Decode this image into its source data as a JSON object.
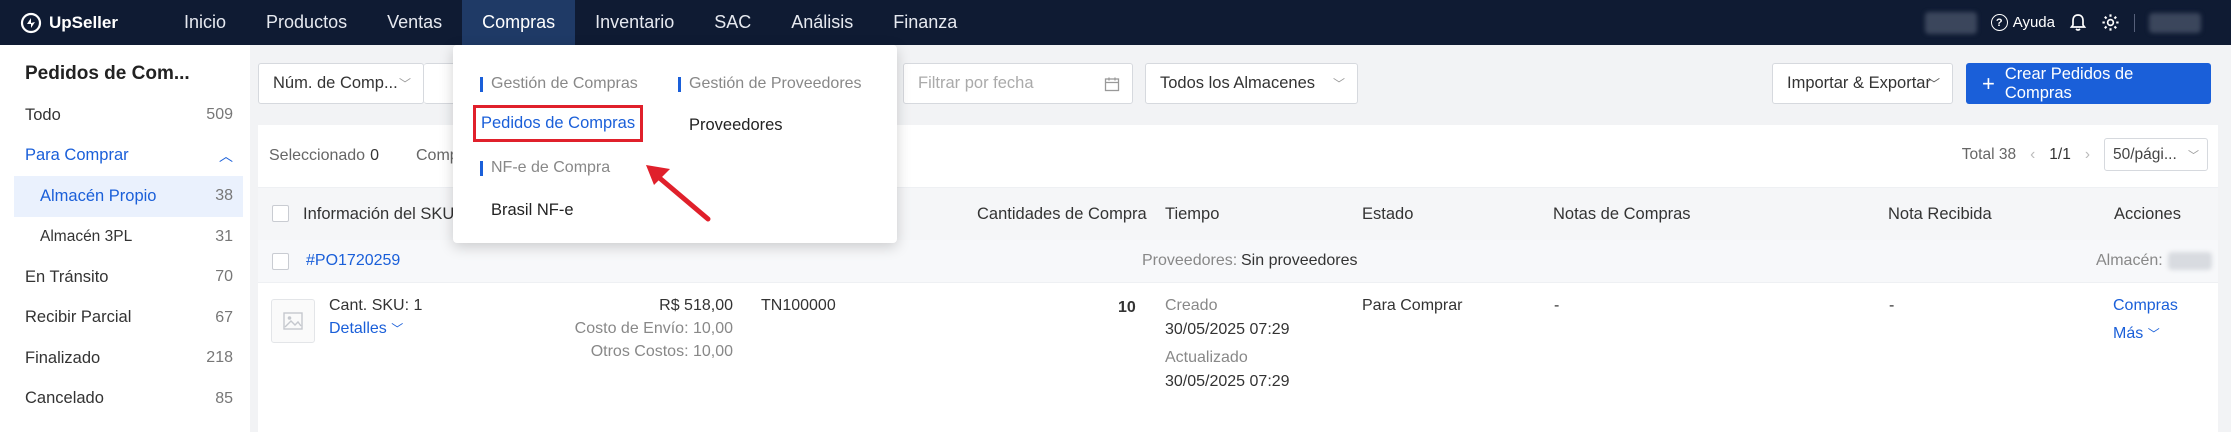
{
  "app": {
    "brand": "UpSeller"
  },
  "nav": {
    "items": [
      "Inicio",
      "Productos",
      "Ventas",
      "Compras",
      "Inventario",
      "SAC",
      "Análisis",
      "Finanza"
    ],
    "active": "Compras"
  },
  "topbar": {
    "help": "Ayuda"
  },
  "sidebar": {
    "title": "Pedidos de Com...",
    "items": [
      {
        "label": "Todo",
        "count": "509"
      },
      {
        "label": "Para Comprar",
        "count": ""
      },
      {
        "label": "Almacén Propio",
        "count": "38"
      },
      {
        "label": "Almacén 3PL",
        "count": "31"
      },
      {
        "label": "En Tránsito",
        "count": "70"
      },
      {
        "label": "Recibir Parcial",
        "count": "67"
      },
      {
        "label": "Finalizado",
        "count": "218"
      },
      {
        "label": "Cancelado",
        "count": "85"
      }
    ]
  },
  "filters": {
    "search_type": "Núm. de Comp...",
    "date_placeholder": "Filtrar por fecha",
    "warehouse": "Todos los Almacenes",
    "import_export": "Importar & Exportar",
    "create": "Crear Pedidos de Compras"
  },
  "toolbar": {
    "selected_label": "Seleccionado",
    "selected_count": "0",
    "partial_btn": "Comp",
    "total": "Total 38",
    "page": "1/1",
    "page_size": "50/pági..."
  },
  "table": {
    "headers": {
      "sku": "Información del SKU",
      "qty": "Cantidades de Compra",
      "time": "Tiempo",
      "status": "Estado",
      "notes": "Notas de Compras",
      "receipt": "Nota Recibida",
      "actions": "Acciones"
    },
    "order": {
      "number": "#PO1720259",
      "supplier_label": "Proveedores:",
      "supplier_value": "Sin proveedores",
      "warehouse_label": "Almacén:"
    },
    "item": {
      "sku_count": "Cant. SKU: 1",
      "details": "Detalles",
      "price": "R$ 518,00",
      "shipping": "Costo de Envío: 10,00",
      "other": "Otros Costos: 10,00",
      "tracking": "TN100000",
      "qty": "10",
      "created_label": "Creado",
      "created": "30/05/2025 07:29",
      "updated_label": "Actualizado",
      "updated": "30/05/2025 07:29",
      "status": "Para Comprar",
      "notes": "-",
      "receipt": "-",
      "action_primary": "Compras",
      "action_more": "Más"
    }
  },
  "dropdown": {
    "head_purchases": "Gestión de Compras",
    "head_suppliers": "Gestión de Proveedores",
    "item_orders": "Pedidos de Compras",
    "item_suppliers": "Proveedores",
    "head_nfe": "NF-e de Compra",
    "item_nfe": "Brasil NF-e"
  },
  "colors": {
    "nav_bg": "#0f1b33",
    "accent": "#1a5fd9",
    "highlight": "#e0202b"
  }
}
